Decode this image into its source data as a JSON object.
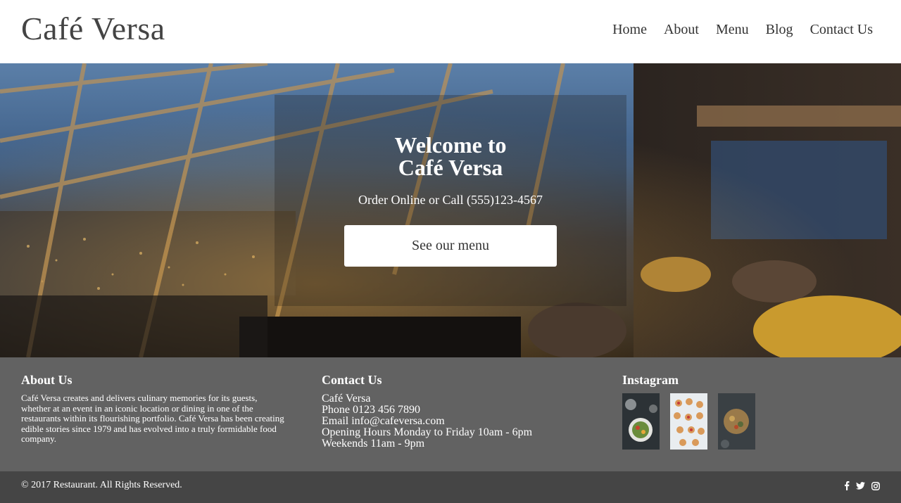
{
  "header": {
    "brand": "Café Versa",
    "nav": [
      "Home",
      "About",
      "Menu",
      "Blog",
      "Contact Us"
    ]
  },
  "hero": {
    "title_line1": "Welcome to",
    "title_line2": "Café Versa",
    "subtitle": "Order Online or Call (555)123-4567",
    "button_label": "See our menu"
  },
  "footer": {
    "about": {
      "heading": "About Us",
      "text": "Café Versa creates and delivers culinary memories for its guests, whether at an event in an iconic location or dining in one of the restaurants within its flourishing portfolio. Café Versa has been creating edible stories since 1979 and has evolved into a truly formidable food company."
    },
    "contact": {
      "heading": "Contact Us",
      "lines": [
        "Café Versa",
        "Phone 0123 456 7890",
        "Email info@cafeversa.com",
        "Opening Hours Monday to Friday 10am - 6pm",
        "Weekends 11am - 9pm"
      ]
    },
    "instagram": {
      "heading": "Instagram",
      "images": [
        "salad-bowl-photo",
        "canapes-platter-photo",
        "grain-bowl-photo"
      ]
    }
  },
  "bottom": {
    "copyright": "© 2017 Restaurant. All Rights Reserved.",
    "socials": [
      "facebook-icon",
      "twitter-icon",
      "instagram-icon"
    ]
  },
  "colors": {
    "footer_bg": "#626262",
    "bottom_bg": "#454545",
    "text_dark": "#333333"
  }
}
